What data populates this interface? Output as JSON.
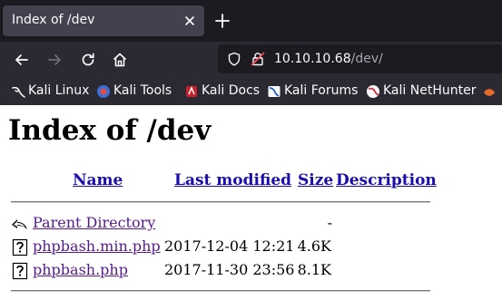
{
  "browser": {
    "tab_title": "Index of /dev",
    "url_host": "10.10.10.68",
    "url_path": "/dev/",
    "bookmarks": [
      {
        "label": "Kali Linux",
        "icon": "kali-dragon-icon"
      },
      {
        "label": "Kali Tools",
        "icon": "kali-tools-icon"
      },
      {
        "label": "Kali Docs",
        "icon": "kali-docs-icon"
      },
      {
        "label": "Kali Forums",
        "icon": "kali-forums-icon"
      },
      {
        "label": "Kali NetHunter",
        "icon": "kali-nethunter-icon"
      }
    ]
  },
  "listing": {
    "heading": "Index of /dev",
    "columns": {
      "name": "Name",
      "last_modified": "Last modified",
      "size": "Size",
      "description": "Description"
    },
    "parent": {
      "name": "Parent Directory",
      "size": "-"
    },
    "files": [
      {
        "name": "phpbash.min.php",
        "modified": "2017-12-04 12:21",
        "size": "4.6K"
      },
      {
        "name": "phpbash.php",
        "modified": "2017-11-30 23:56",
        "size": "8.1K"
      }
    ]
  },
  "colors": {
    "tab_bar": "#1c1b22",
    "toolbar": "#2b2a33",
    "link": "#1a0dab",
    "visited_link": "#551a8b"
  }
}
